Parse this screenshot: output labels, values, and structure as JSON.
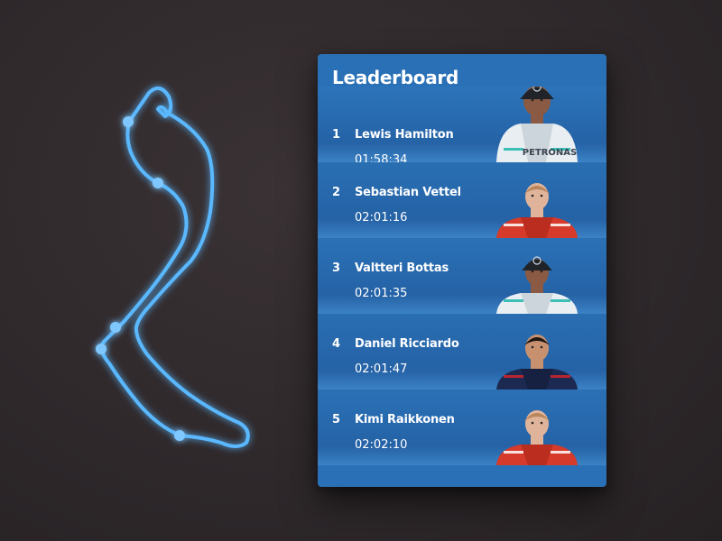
{
  "leaderboard": {
    "title": "Leaderboard",
    "drivers": [
      {
        "rank": "1",
        "name": "Lewis Hamilton",
        "time": "01:58:34",
        "team": "mercedes"
      },
      {
        "rank": "2",
        "name": "Sebastian Vettel",
        "time": "02:01:16",
        "team": "ferrari"
      },
      {
        "rank": "3",
        "name": "Valtteri Bottas",
        "time": "02:01:35",
        "team": "mercedes"
      },
      {
        "rank": "4",
        "name": "Daniel Ricciardo",
        "time": "02:01:47",
        "team": "redbull"
      },
      {
        "rank": "5",
        "name": "Kimi Raikkonen",
        "time": "02:02:10",
        "team": "ferrari"
      }
    ],
    "badge_text": "PETRONAS"
  },
  "colors": {
    "background": "#2e282b",
    "panel": "#2a70b6",
    "track": "#5ab8ff",
    "text": "#ffffff"
  }
}
